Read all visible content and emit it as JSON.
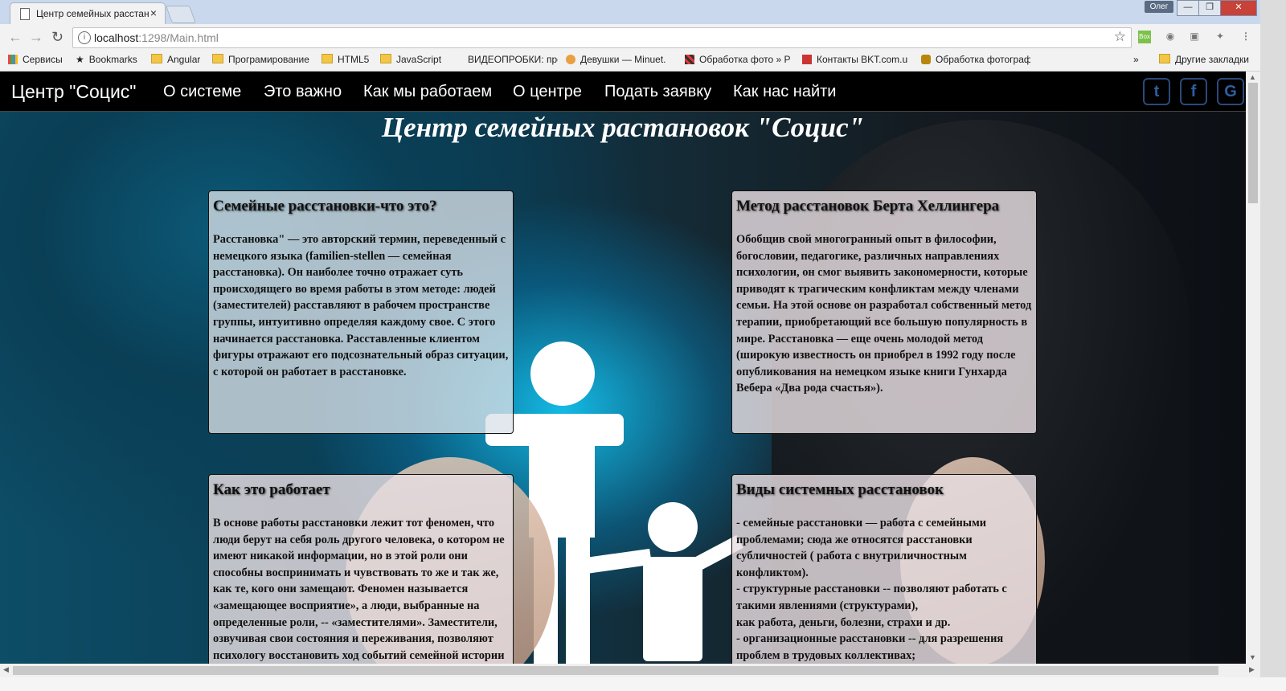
{
  "browser": {
    "tab_title": "Центр семейных расстановок \"Социс\"",
    "tab_close": "×",
    "user": "Олег",
    "url_host": "localhost",
    "url_rest": ":1298/Main.html",
    "window_controls": {
      "min": "—",
      "max": "❐",
      "close": "✕"
    }
  },
  "bookmarks": [
    {
      "label": "Сервисы",
      "icon": "apps-grid-icon"
    },
    {
      "label": "Bookmarks",
      "icon": "star-icon"
    },
    {
      "label": "Angular",
      "icon": "folder-icon"
    },
    {
      "label": "Програмирование",
      "icon": "folder-icon"
    },
    {
      "label": "HTML5",
      "icon": "folder-icon"
    },
    {
      "label": "JavaScript",
      "icon": "folder-icon"
    },
    {
      "label": "ВИДЕОПРОБКИ: про",
      "icon": "page-icon"
    },
    {
      "label": "Девушки — Minuet.",
      "icon": "site-icon"
    },
    {
      "label": "Обработка фото » P",
      "icon": "site-icon"
    },
    {
      "label": "Контакты BKT.com.u",
      "icon": "site-icon"
    },
    {
      "label": "Обработка фотограф",
      "icon": "site-icon"
    },
    {
      "label": "»",
      "icon": ""
    },
    {
      "label": "Другие закладки",
      "icon": "folder-icon"
    }
  ],
  "navbar": {
    "brand": "Центр \"Социс\"",
    "links": [
      "О системе",
      "Это важно",
      "Как мы работаем",
      "О центре",
      "Подать заявку",
      "Как нас найти"
    ],
    "social": [
      "twitter-icon",
      "facebook-icon",
      "google-icon"
    ],
    "social_glyphs": [
      "t",
      "f",
      "G"
    ]
  },
  "main": {
    "heading": "Центр семейных растановок \"Социс\"",
    "cards": [
      {
        "title": "Семейные расстановки-что это?",
        "text": "Расстановка\" — это авторский термин, переведенный с немецкого языка (familien-stellen — семейная расстановка). Он наиболее точно отражает суть происходящего во время работы в этом методе: людей (заместителей) расставляют в рабочем пространстве группы, интуитивно определяя каждому свое. С этого начинается расстановка. Расставленные клиентом фигуры отражают его подсознательный образ ситуации, с которой он работает в расстановке."
      },
      {
        "title": "Метод расстановок Берта Хеллингера",
        "text": "Обобщив свой многогранный опыт в философии, богословии, педагогике, различных направлениях психологии, он смог выявить закономерности, которые приводят к трагическим конфликтам между членами семьи. На этой основе он разработал собственный метод терапии, приобретающий все большую популярность в мире. Расстановка — еще очень молодой метод (широкую известность он приобрел в 1992 году после опубликования на немецком языке книги Гунхарда Вебера «Два рода счастья»)."
      },
      {
        "title": "Как это работает",
        "text": "В основе работы расстановки лежит тот феномен, что люди берут на себя роль другого человека, о котором не имеют никакой информации, но в этой роли они способны воспринимать и чувствовать то же и так же, как те, кого они замещают. Феномен называется «замещающее восприятие», а люди, выбранные на определенные роли, -- «заместителями». Заместители, озвучивая свои состояния и переживания, позволяют психологу восстановить ход событий семейной истории"
      },
      {
        "title": "Виды системных расстановок",
        "text": "- семейные расстановки — работа с семейными проблемами; сюда же относятся расстановки субличностей ( работа с внутриличностным конфликтом).\n- структурные расстановки -- позволяют работать с такими явлениями (структурами),\nкак работа, деньги, болезни, страхи и др.\n- организационные расстановки -- для разрешения проблем в трудовых коллективах;"
      }
    ]
  }
}
